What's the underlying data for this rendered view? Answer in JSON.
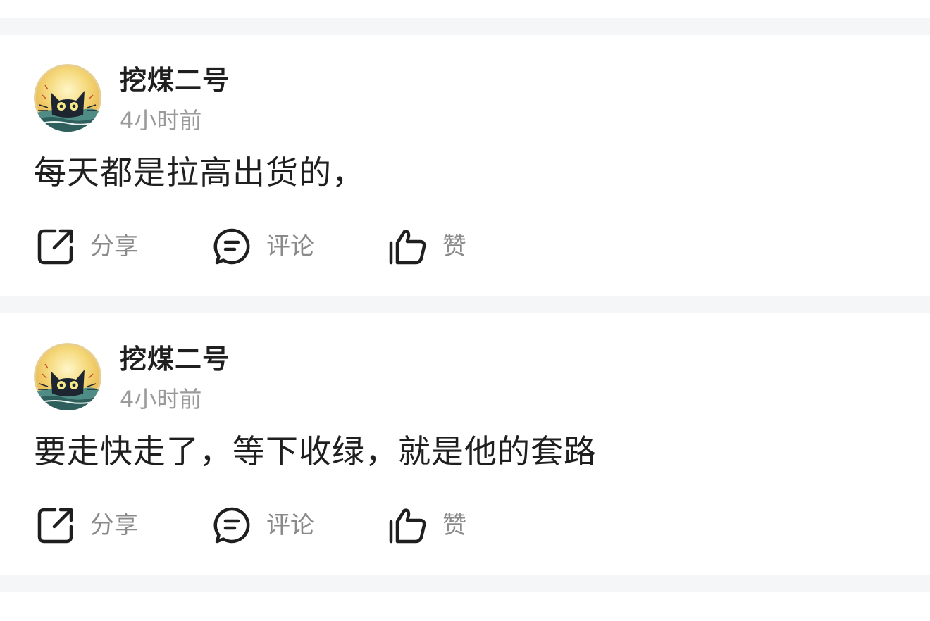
{
  "posts": [
    {
      "username": "挖煤二号",
      "time": "4小时前",
      "content": "每天都是拉高出货的，",
      "actions": {
        "share": "分享",
        "comment": "评论",
        "like": "赞"
      },
      "avatar_icon": "black-cat-sunset-avatar"
    },
    {
      "username": "挖煤二号",
      "time": "4小时前",
      "content": "要走快走了，等下收绿，就是他的套路",
      "actions": {
        "share": "分享",
        "comment": "评论",
        "like": "赞"
      },
      "avatar_icon": "black-cat-sunset-avatar"
    }
  ],
  "colors": {
    "separator": "#f5f6f8",
    "username": "#1f1f1f",
    "time": "#9a9a9a",
    "action_label": "#8a8a8a",
    "icon_stroke": "#1f1f1f"
  }
}
